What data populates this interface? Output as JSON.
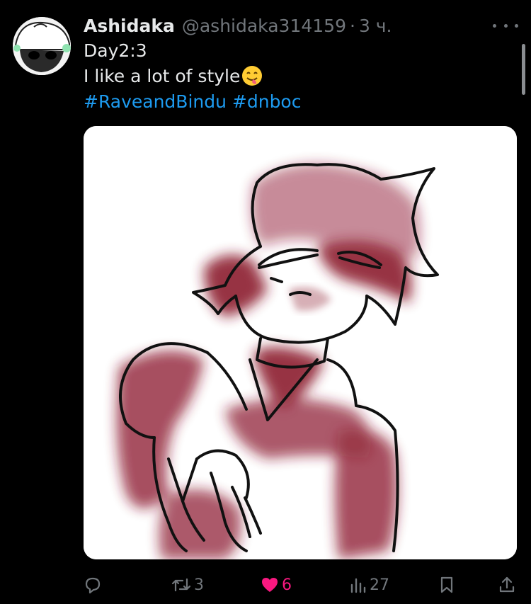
{
  "tweet": {
    "author_name": "Ashidaka",
    "handle": "@ashidaka314159",
    "separator": "·",
    "time": "3 ч.",
    "lines": [
      "Day2:3",
      "I like a lot of style"
    ],
    "emoji": "smiling-face-with-tongue",
    "hashtags": [
      "#RaveandBindu",
      "#dnboc"
    ],
    "image_alt": "Drawing of a character with dark red hair and shading"
  },
  "actions": {
    "replies": "",
    "reposts": "3",
    "likes": "6",
    "liked": true,
    "views": "27"
  },
  "colors": {
    "background": "#000000",
    "text": "#e7e9ea",
    "muted": "#71767b",
    "link": "#1d9bf0",
    "like": "#f91880",
    "art_red": "#8c1a2e"
  }
}
